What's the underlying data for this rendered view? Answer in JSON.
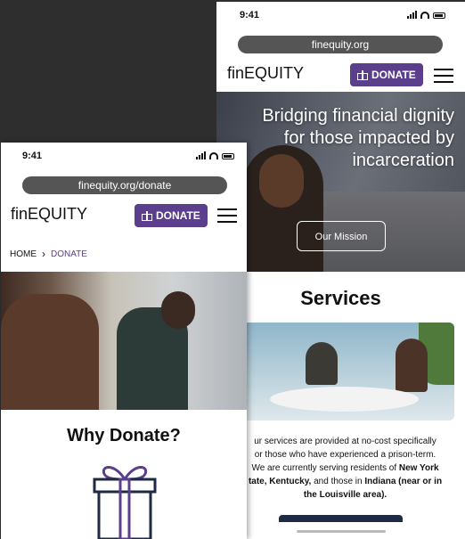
{
  "back": {
    "status": {
      "time": "9:41"
    },
    "url": "finequity.org",
    "brand": "finEQUITY",
    "donate_label": "DONATE",
    "hero": {
      "title_line1": "Bridging financial dignity",
      "title_line2": "for those impacted by",
      "title_line3": "incarceration",
      "button_label": "Our Mission"
    },
    "services": {
      "title": "Services",
      "text_parts": [
        "ur services are provided at no-cost specifically",
        "or those who have experienced a prison-term.",
        "We are currently serving residents of ",
        "New York",
        "tate, Kentucky,",
        " and those in ",
        "Indiana (near or in",
        "the Louisville area)."
      ]
    }
  },
  "front": {
    "status": {
      "time": "9:41"
    },
    "url": "finequity.org/donate",
    "brand": "finEQUITY",
    "donate_label": "DONATE",
    "breadcrumb": {
      "home": "HOME",
      "current": "DONATE"
    },
    "section_title": "Why Donate?"
  },
  "colors": {
    "accent": "#5b3f8c",
    "background": "#2e2e2e",
    "url_bar": "#555555"
  }
}
